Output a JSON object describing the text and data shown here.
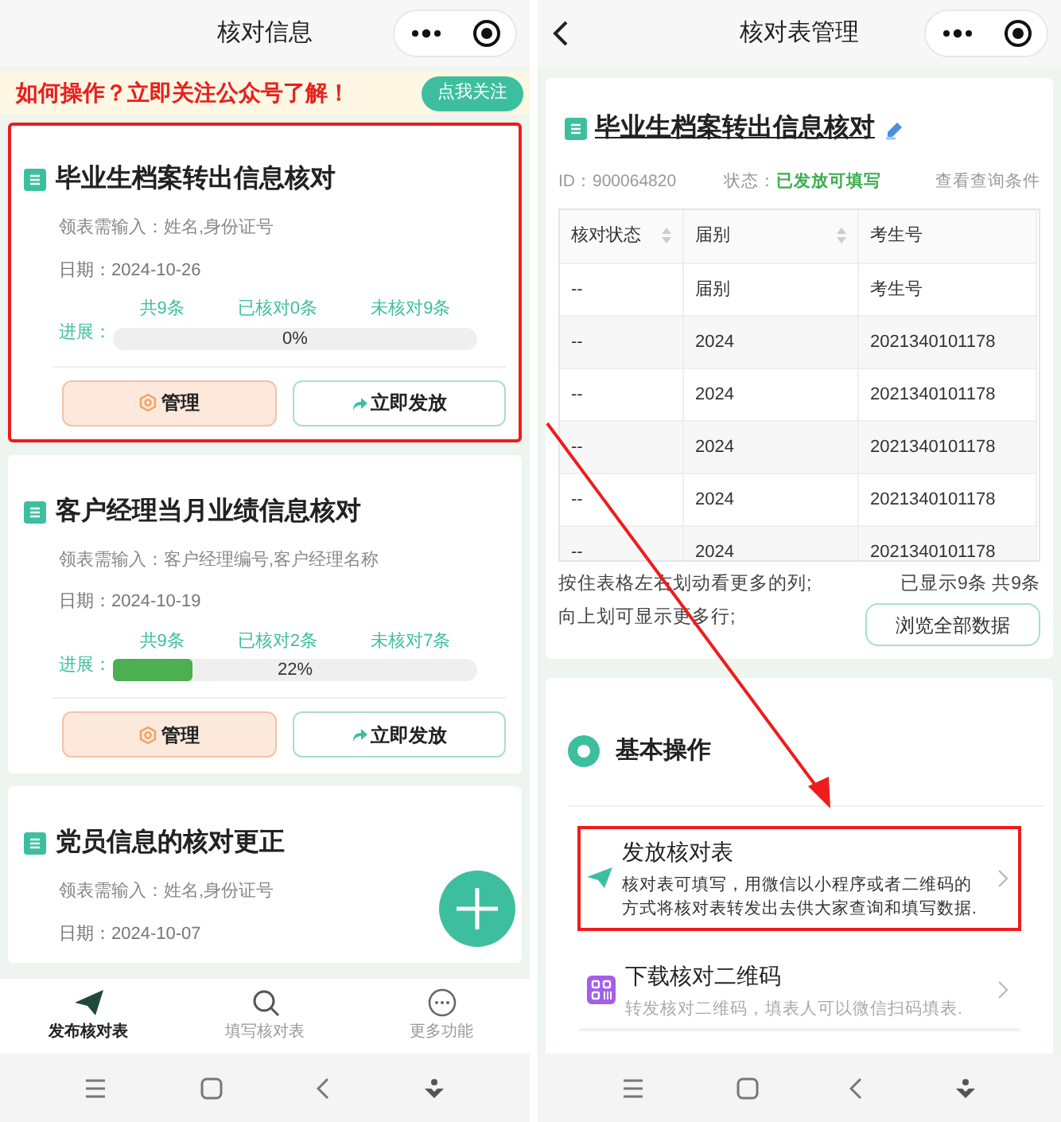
{
  "left_screen": {
    "title": "核对信息",
    "banner": {
      "text": "如何操作？立即关注公众号了解！",
      "button": "点我关注"
    },
    "cards": [
      {
        "title": "毕业生档案转出信息核对",
        "input_hint": "领表需输入：姓名,身份证号",
        "date": "日期：2024-10-26",
        "progress_label": "进展：",
        "total": "共9条",
        "checked": "已核对0条",
        "unchecked": "未核对9条",
        "level": 0,
        "percent": "0%",
        "buttons": [
          "管理",
          "立即发放"
        ],
        "highlighted": true
      },
      {
        "title": "客户经理当月业绩信息核对",
        "input_hint": "领表需输入：客户经理编号,客户经理名称",
        "date": "日期：2024-10-19",
        "progress_label": "进展：",
        "total": "共9条",
        "checked": "已核对2条",
        "unchecked": "未核对7条",
        "level": 0.22,
        "percent": "22%",
        "buttons": [
          "管理",
          "立即发放"
        ],
        "highlighted": false
      },
      {
        "title": "党员信息的核对更正",
        "input_hint": "领表需输入：姓名,身份证号",
        "date": "日期：2024-10-07",
        "highlighted": false
      }
    ],
    "tabs": [
      {
        "label": "发布核对表",
        "selected": true
      },
      {
        "label": "填写核对表",
        "selected": false
      },
      {
        "label": "更多功能",
        "selected": false
      }
    ]
  },
  "right_screen": {
    "title": "核对表管理",
    "sheet": {
      "title": "毕业生档案转出信息核对",
      "id": "ID：900064820",
      "status_label": "状态：",
      "status": "已发放可填写",
      "link": "查看查询条件",
      "table": {
        "columns": [
          {
            "label": "核对状态",
            "sortable": true
          },
          {
            "label": "届别",
            "sortable": true
          },
          {
            "label": "考生号",
            "sortable": false
          }
        ],
        "rows": [
          [
            "--",
            "届别",
            "考生号"
          ],
          [
            "--",
            "2024",
            "2021340101178"
          ],
          [
            "--",
            "2024",
            "2021340101178"
          ],
          [
            "--",
            "2024",
            "2021340101178"
          ],
          [
            "--",
            "2024",
            "2021340101178"
          ],
          [
            "--",
            "2024",
            "2021340101178"
          ]
        ]
      },
      "hint_lines": [
        "按住表格左右划动看更多的列;",
        "向上划可显示更多行;"
      ],
      "count": "已显示9条 共9条",
      "button": "浏览全部数据"
    },
    "operations": {
      "title": "基本操作",
      "items": [
        {
          "kind": "send",
          "title": "发放核对表",
          "description": "核对表可填写，用微信以小程序或者二维码的方式将核对表转发出去供大家查询和填写数据.",
          "highlighted": true
        },
        {
          "kind": "qrcode",
          "title": "下载核对二维码",
          "description": "转发核对二维码，填表人可以微信扫码填表.",
          "highlighted": false
        }
      ]
    }
  }
}
